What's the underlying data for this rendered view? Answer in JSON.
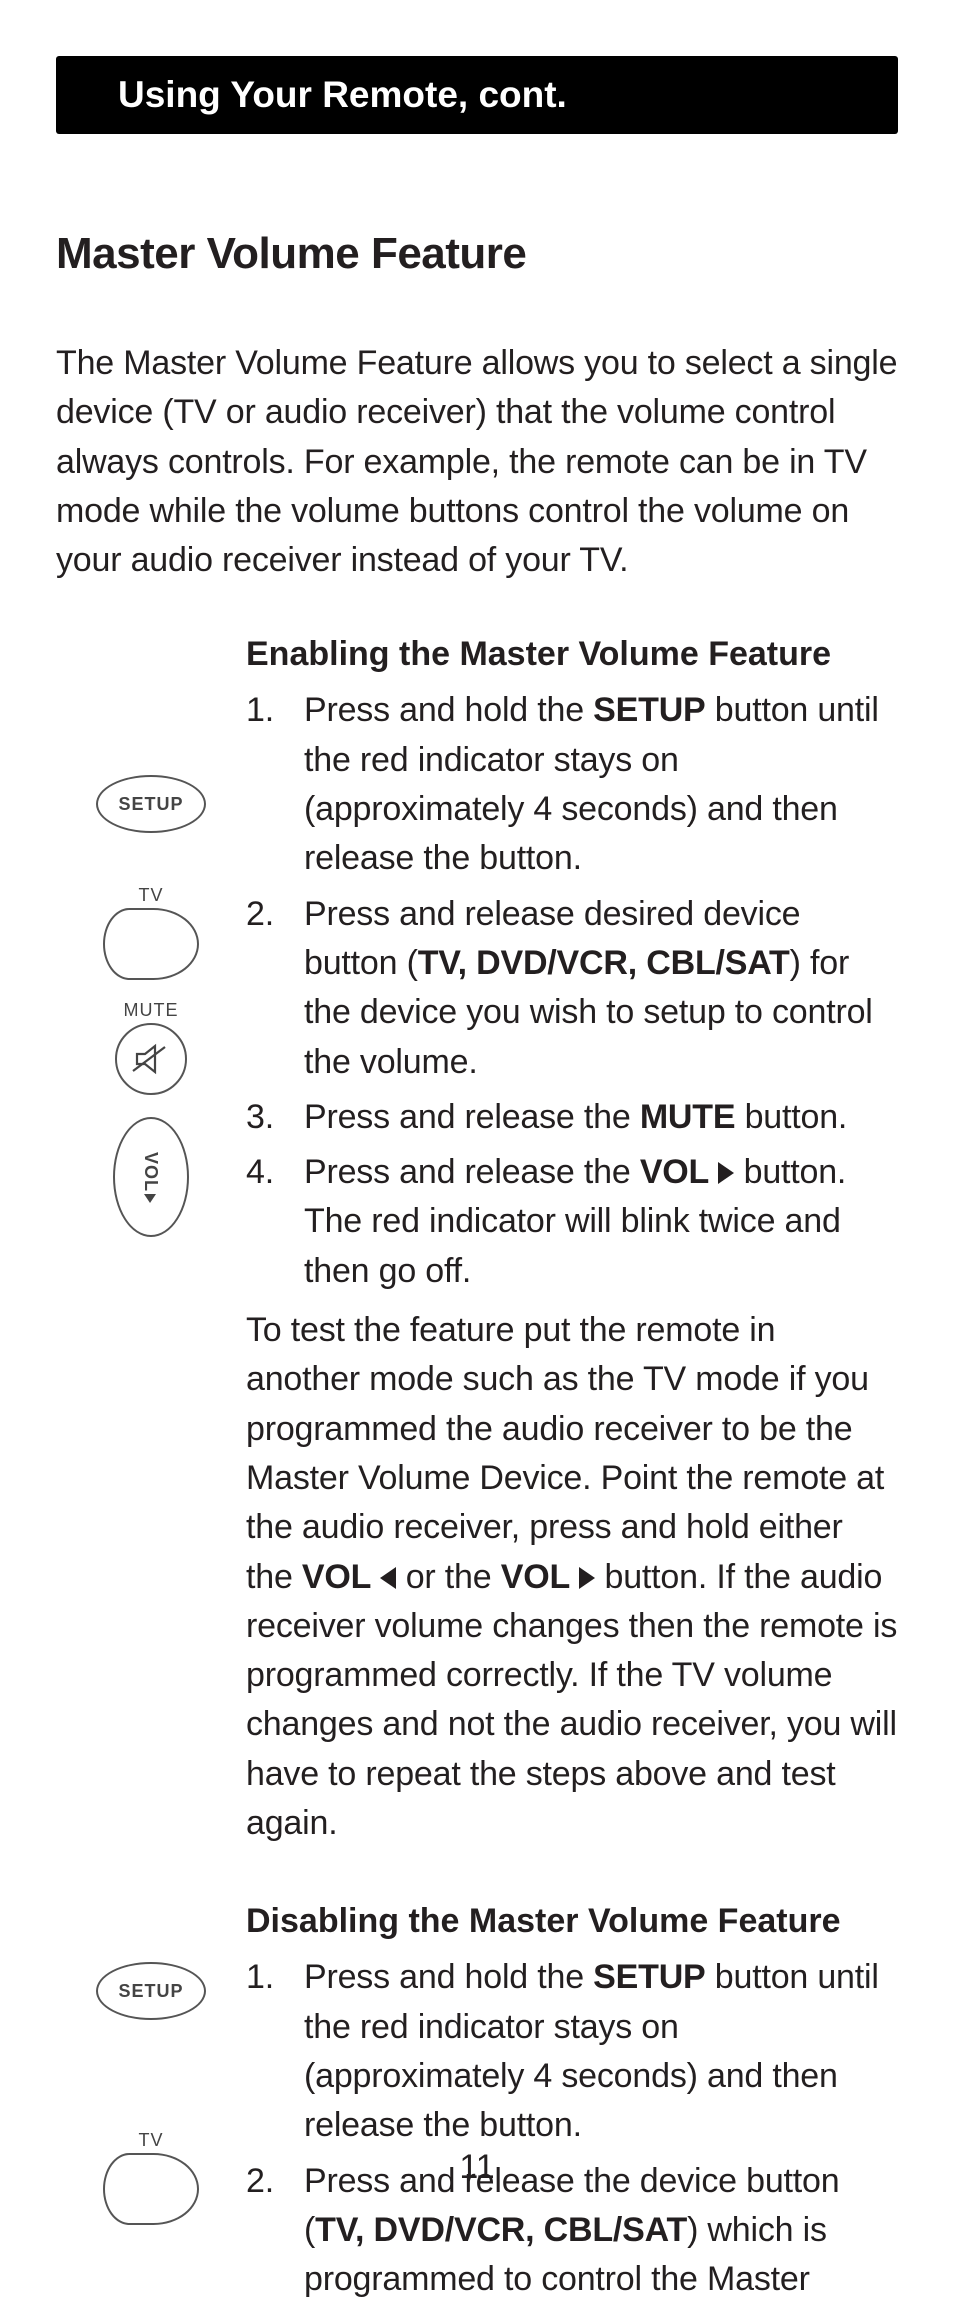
{
  "header": {
    "title": "Using Your Remote, cont."
  },
  "section": {
    "title": "Master Volume Feature"
  },
  "intro": "The Master Volume Feature allows you to select a single device (TV or audio receiver) that the volume control always controls. For example, the remote can be in TV mode while the volume buttons control the volume on your audio receiver instead of your TV.",
  "enabling": {
    "heading": "Enabling the Master Volume Feature",
    "steps": {
      "s1a": "Press and hold the ",
      "s1b": "SETUP",
      "s1c": " button until the red indicator stays on (approximately 4 seconds) and then release the button.",
      "s2a": "Press and release desired device button (",
      "s2b": "TV, DVD/VCR, CBL/SAT",
      "s2c": ") for the device you wish to setup to control the volume.",
      "s3a": "Press and release the ",
      "s3b": "MUTE",
      "s3c": " button.",
      "s4a": "Press and release the ",
      "s4b": "VOL",
      "s4c": " button. The red indicator will blink twice and then go off."
    },
    "test_a": "To test the feature put the remote in another mode such as the TV mode if you programmed the audio receiver to be the Master Volume Device. Point the remote at the audio receiver, press and hold either the ",
    "test_b": "VOL",
    "test_c": " or the ",
    "test_d": "VOL",
    "test_e": " button. If the audio receiver volume changes then the remote is programmed correctly. If the TV volume changes and not the audio receiver, you will have to repeat the steps above and test again."
  },
  "disabling": {
    "heading": "Disabling the Master Volume Feature",
    "steps": {
      "s1a": "Press and hold the ",
      "s1b": "SETUP",
      "s1c": " button until the red indicator stays on (approximately 4 seconds) and then release the button.",
      "s2a": "Press and release the device button (",
      "s2b": "TV, DVD/VCR, CBL/SAT",
      "s2c": ") which is programmed to control the Master"
    }
  },
  "icons": {
    "setup": "SETUP",
    "tv": "TV",
    "mute": "MUTE",
    "vol": "VOL"
  },
  "page_number": "11"
}
